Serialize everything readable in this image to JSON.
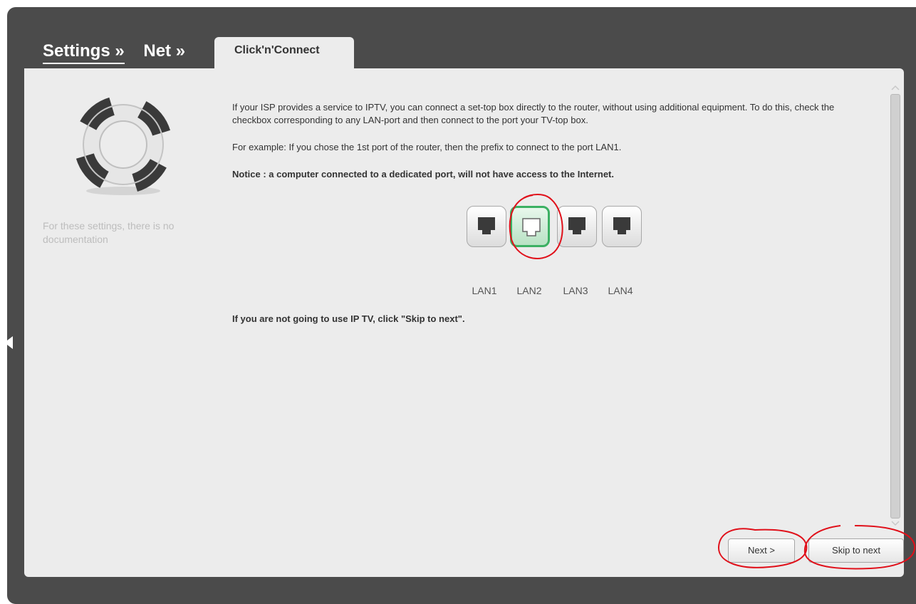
{
  "breadcrumbs": [
    "Settings »",
    "Net »"
  ],
  "tab_label": "Click'n'Connect",
  "sidebar": {
    "icon": "lifebuoy-icon",
    "note": "For these settings, there is no documentation"
  },
  "content": {
    "intro": "If your ISP provides a service to IPTV, you can connect a set-top box directly to the router, without using additional equipment. To do this, check the checkbox corresponding to any LAN-port and then connect to the port your TV-top box.",
    "example": "For example: If you chose the 1st port of the router, then the prefix to connect to the port LAN1.",
    "notice": "Notice : a computer connected to a dedicated port, will not have access to the Internet.",
    "skip_note": "If you are not going to use IP TV, click \"Skip to next\"."
  },
  "ports": [
    {
      "label": "LAN1",
      "selected": false
    },
    {
      "label": "LAN2",
      "selected": true
    },
    {
      "label": "LAN3",
      "selected": false
    },
    {
      "label": "LAN4",
      "selected": false
    }
  ],
  "buttons": {
    "next": "Next >",
    "skip": "Skip to next"
  },
  "colors": {
    "frame": "#4b4b4b",
    "panel": "#ececec",
    "selected_port": "#3cb063",
    "annotation": "#e0101a"
  }
}
